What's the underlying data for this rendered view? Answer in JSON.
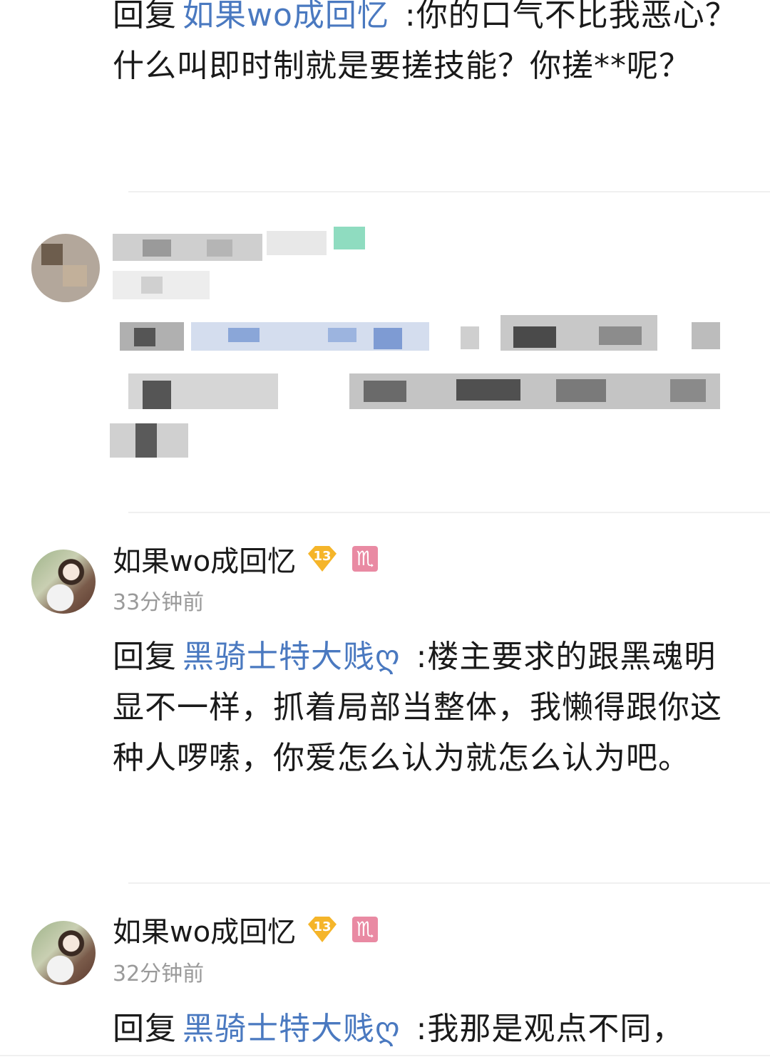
{
  "comments": [
    {
      "reply_prefix": "回复",
      "reply_to": "如果wo成回忆",
      "text": ":你的口气不比我恶心？什么叫即时制就是要搓技能？你搓**呢？"
    },
    {
      "username": "如果wo成回忆",
      "level": "13",
      "zodiac": "♏",
      "time": "33分钟前",
      "reply_prefix": "回复",
      "reply_to": "黑骑士特大贱ღ",
      "text": ":楼主要求的跟黑魂明显不一样，抓着局部当整体，我懒得跟你这种人啰嗦，你爱怎么认为就怎么认为吧。"
    },
    {
      "username": "如果wo成回忆",
      "level": "13",
      "zodiac": "♏",
      "time": "32分钟前",
      "reply_prefix": "回复",
      "reply_to": "黑骑士特大贱ღ",
      "text": ":我那是观点不同，"
    }
  ],
  "colors": {
    "link": "#4a79c0",
    "level_badge": "#f5b52a",
    "zodiac_badge": "#e98aa3",
    "lz_badge": "#5fc9a0"
  }
}
